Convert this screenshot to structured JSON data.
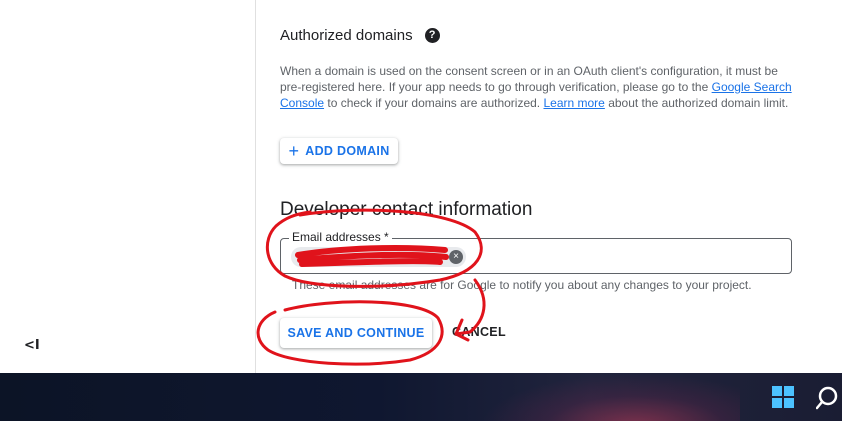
{
  "sidebar": {
    "collapse_icon": "collapse-sidebar-icon",
    "collapse_label": "<I"
  },
  "authorized_domains": {
    "title": "Authorized domains",
    "help_icon": "help-icon",
    "help_glyph": "?",
    "desc_part1": "When a domain is used on the consent screen or in an OAuth client's configuration, it must be pre-registered here. If your app needs to go through verification, please go to the ",
    "link1": "Google Search Console",
    "desc_part2": " to check if your domains are authorized. ",
    "link2": "Learn more",
    "desc_part3": " about the authorized domain limit.",
    "add_button_icon": "+",
    "add_button_label": "ADD DOMAIN"
  },
  "developer_contact": {
    "title": "Developer contact information",
    "email_label": "Email addresses *",
    "email_chip_value": "",
    "chip_close_glyph": "×",
    "hint": "These email addresses are for Google to notify you about any changes to your project."
  },
  "actions": {
    "save_label": "SAVE AND CONTINUE",
    "cancel_label": "CANCEL"
  },
  "annotation": {
    "color": "#e0131b"
  },
  "taskbar": {
    "start_icon": "windows-start-icon",
    "search_icon": "search-icon"
  }
}
